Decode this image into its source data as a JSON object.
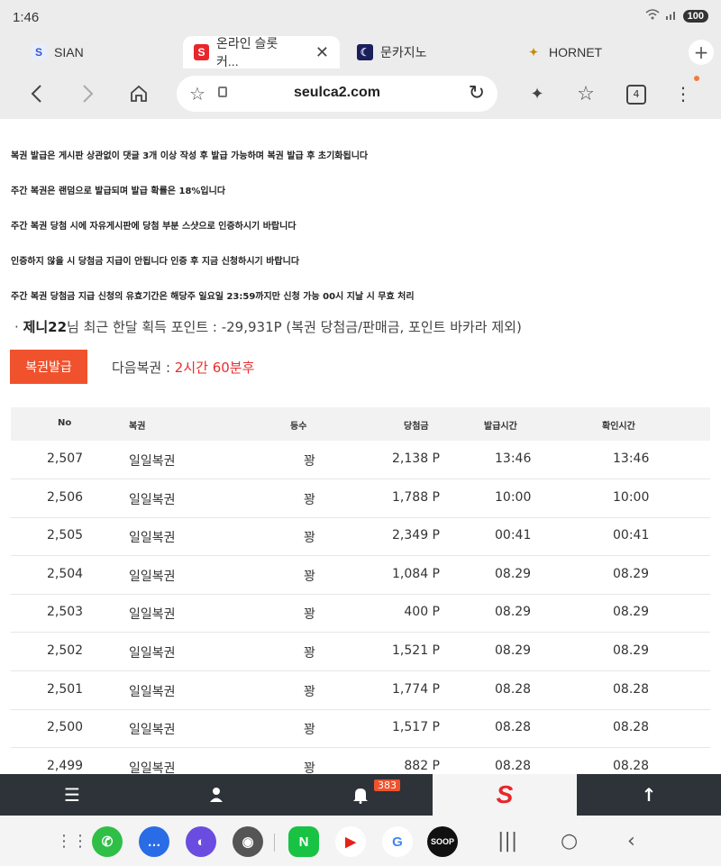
{
  "status": {
    "time": "1:46",
    "battery": "100"
  },
  "tabs": [
    {
      "label": "SIAN",
      "favicon": "S"
    },
    {
      "label": "온라인 슬롯커...",
      "favicon": "S",
      "close": "✕"
    },
    {
      "label": "문카지노",
      "favicon": "☾"
    },
    {
      "label": "HORNET",
      "favicon": "✦"
    }
  ],
  "browser": {
    "url": "seulca2.com",
    "tab_count": "4"
  },
  "notices": [
    "복권 발급은 게시판 상관없이 댓글 3개 이상 작성 후 발급 가능하며 복권 발급 후 초기화됩니다",
    "주간 복권은 랜덤으로 발급되며 발급 확률은 18%입니다",
    "주간 복권 당첨 시에 자유게시판에 당첨 부분 스샷으로 인증하시기 바랍니다",
    "인증하지 않을 시 당첨금 지급이 안됩니다 인증 후 지금 신청하시기 바랍니다",
    "주간 복권 당첨금 지급 신청의 유효기간은 해당주 일요일 23:59까지만 신청 가능 00시 지날 시 무효 처리"
  ],
  "summary": {
    "bullet": "·",
    "user": "제니22",
    "text": "님 최근 한달 획득 포인트 : -29,931P (복권 당첨금/판매금, 포인트 바카라 제외)"
  },
  "issue_button": "복권발급",
  "next_lottery": {
    "label": "다음복권 : ",
    "value": "2시간 60분후"
  },
  "table": {
    "headers": [
      "No",
      "복권",
      "등수",
      "당첨금",
      "발급시간",
      "확인시간"
    ],
    "rows": [
      [
        "2,507",
        "일일복권",
        "꽝",
        "2,138 P",
        "13:46",
        "13:46"
      ],
      [
        "2,506",
        "일일복권",
        "꽝",
        "1,788 P",
        "10:00",
        "10:00"
      ],
      [
        "2,505",
        "일일복권",
        "꽝",
        "2,349 P",
        "00:41",
        "00:41"
      ],
      [
        "2,504",
        "일일복권",
        "꽝",
        "1,084 P",
        "08.29",
        "08.29"
      ],
      [
        "2,503",
        "일일복권",
        "꽝",
        "400 P",
        "08.29",
        "08.29"
      ],
      [
        "2,502",
        "일일복권",
        "꽝",
        "1,521 P",
        "08.29",
        "08.29"
      ],
      [
        "2,501",
        "일일복권",
        "꽝",
        "1,774 P",
        "08.28",
        "08.28"
      ],
      [
        "2,500",
        "일일복권",
        "꽝",
        "1,517 P",
        "08.28",
        "08.28"
      ],
      [
        "2,499",
        "일일복권",
        "꽝",
        "882 P",
        "08.28",
        "08.28"
      ]
    ]
  },
  "site_nav": {
    "notification_count": "383",
    "logo": "S"
  },
  "colors": {
    "accent": "#f0522d",
    "highlight": "#ea2d2d",
    "nav_bg": "#2d3339"
  }
}
